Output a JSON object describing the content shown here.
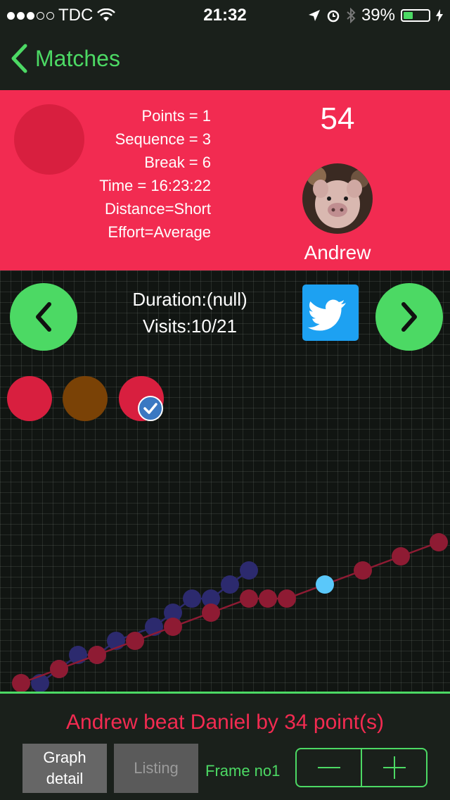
{
  "status_bar": {
    "carrier": "TDC",
    "time": "21:32",
    "battery": "39%",
    "battery_level": 0.39
  },
  "nav": {
    "back_label": "Matches"
  },
  "shot": {
    "points": "Points = 1",
    "sequence": "Sequence = 3",
    "break": "Break = 6",
    "time": "Time = 16:23:22",
    "distance": "Distance=Short",
    "effort": "Effort=Average"
  },
  "player": {
    "score": "54",
    "name": "Andrew"
  },
  "match_info": {
    "duration": "Duration:(null)",
    "visits": "Visits:10/21"
  },
  "colors": {
    "accent": "#4cd964",
    "panel": "#f22b51",
    "series_red": "#8e1b33",
    "series_blue": "#2c2a6e",
    "highlight": "#5ac8fa"
  },
  "chart_data": {
    "type": "line",
    "series": [
      {
        "name": "Andrew",
        "color": "#8e1b33",
        "points": [
          [
            0,
            0
          ],
          [
            2,
            1
          ],
          [
            4,
            2
          ],
          [
            6,
            3
          ],
          [
            8,
            4
          ],
          [
            10,
            5
          ],
          [
            12,
            6
          ],
          [
            13,
            6
          ],
          [
            14,
            6
          ],
          [
            16,
            7
          ],
          [
            18,
            8
          ],
          [
            20,
            9
          ],
          [
            22,
            10
          ]
        ],
        "highlight_index": 9
      },
      {
        "name": "Daniel",
        "color": "#2c2a6e",
        "points": [
          [
            1,
            0
          ],
          [
            2,
            1
          ],
          [
            3,
            2
          ],
          [
            4,
            2
          ],
          [
            5,
            3
          ],
          [
            7,
            4
          ],
          [
            8,
            5
          ],
          [
            9,
            6
          ],
          [
            10,
            6
          ],
          [
            11,
            7
          ],
          [
            12,
            8
          ]
        ]
      }
    ]
  },
  "summary": {
    "result": "Andrew beat Daniel by 34 point(s)"
  },
  "controls": {
    "graph_detail": "Graph\ndetail",
    "listing": "Listing",
    "frame": "Frame no1"
  }
}
